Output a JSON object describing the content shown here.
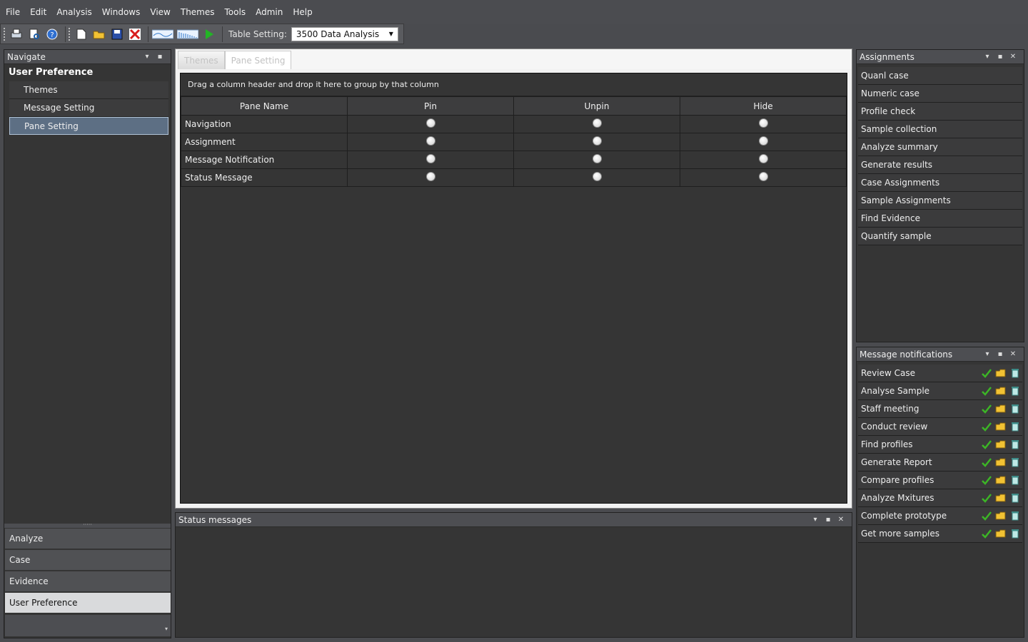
{
  "menu": [
    "File",
    "Edit",
    "Analysis",
    "Windows",
    "View",
    "Themes",
    "Tools",
    "Admin",
    "Help"
  ],
  "toolbar": {
    "table_setting_label": "Table Setting:",
    "table_setting_value": "3500 Data Analysis"
  },
  "navigate": {
    "title": "Navigate",
    "section": "User Preference",
    "items": [
      "Themes",
      "Message Setting",
      "Pane Setting"
    ],
    "selected": "Pane Setting",
    "outlook_bar": [
      "Analyze",
      "Case",
      "Evidence",
      "User Preference"
    ],
    "outlook_selected": "User Preference"
  },
  "center": {
    "tabs": [
      "Themes",
      "Pane Setting"
    ],
    "active_tab": "Pane Setting",
    "group_hint": "Drag a column header and drop it here to group by that column",
    "columns": [
      "Pane Name",
      "Pin",
      "Unpin",
      "Hide"
    ],
    "rows": [
      "Navigation",
      "Assignment",
      "Message Notification",
      "Status Message"
    ]
  },
  "status": {
    "title": "Status messages"
  },
  "assignments": {
    "title": "Assignments",
    "items": [
      "Quanl case",
      "Numeric case",
      "Profile check",
      "Sample collection",
      "Analyze summary",
      "Generate results",
      "Case Assignments",
      "Sample Assignments",
      "Find Evidence",
      "Quantify sample"
    ]
  },
  "messages": {
    "title": "Message notifications",
    "items": [
      "Review Case",
      "Analyse Sample",
      "Staff meeting",
      "Conduct review",
      "Find profiles",
      "Generate Report",
      "Compare profiles",
      "Analyze Mxitures",
      "Complete prototype",
      "Get more samples"
    ]
  },
  "colors": {
    "accent_selected": "#5d6f84",
    "check_green": "#3cb526",
    "folder_yellow": "#f2c233"
  }
}
